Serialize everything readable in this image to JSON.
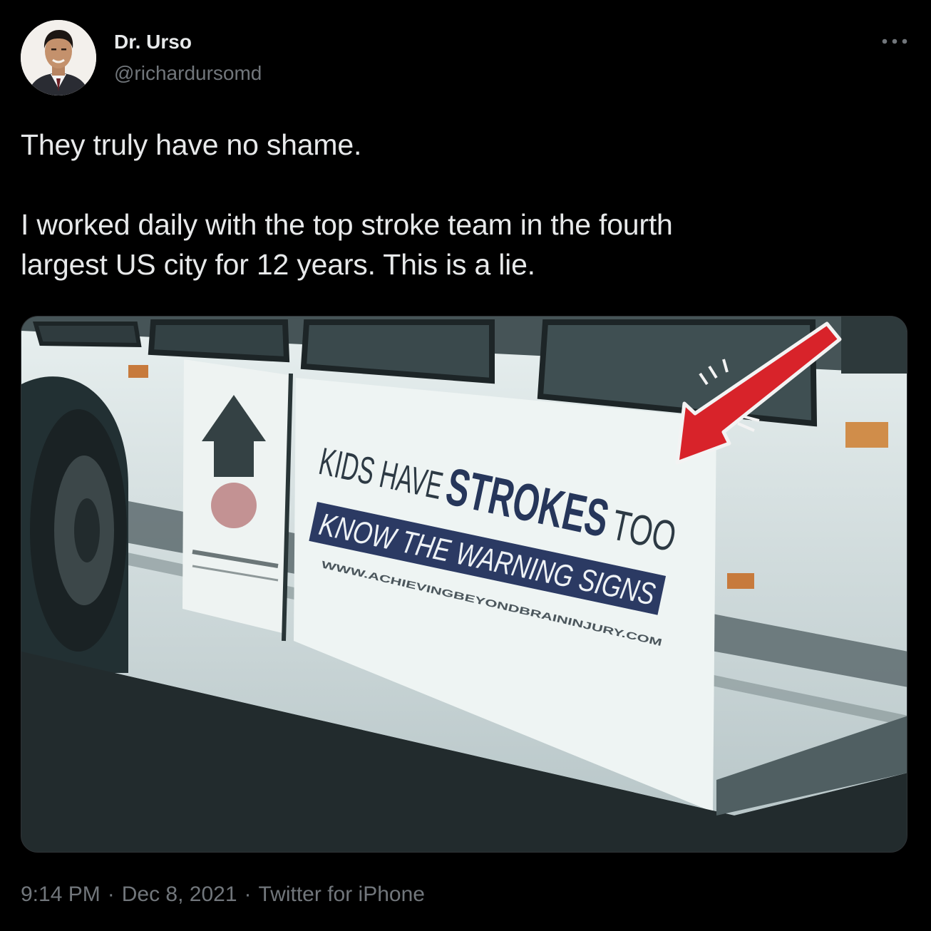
{
  "author": {
    "display_name": "Dr. Urso",
    "handle": "@richardursomd"
  },
  "tweet": {
    "lines": [
      "They truly have no shame.",
      "I worked daily with the top stroke team in the fourth",
      "largest US city for 12 years. This is a lie."
    ]
  },
  "media": {
    "sign_line_1_left": "KIDS HAVE",
    "sign_line_1_bold": "STROKES",
    "sign_line_1_right": "TOO",
    "sign_line_2": "KNOW THE WARNING SIGNS",
    "sign_url": "WWW.ACHIEVINGBEYONDBRAININJURY.COM",
    "arrow_color": "#d8232a",
    "sign_accent_color": "#2b3a63"
  },
  "footer": {
    "time": "9:14 PM",
    "separator": "·",
    "date": "Dec 8, 2021",
    "source": "Twitter for iPhone"
  },
  "icons": {
    "more": "more-horizontal-icon"
  }
}
